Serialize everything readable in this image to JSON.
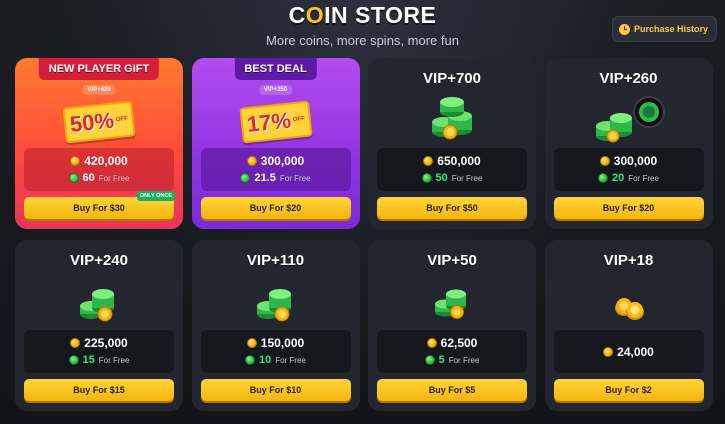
{
  "header": {
    "title_prefix": "C",
    "title_o": "O",
    "title_suffix": "IN STORE",
    "subtitle": "More coins, more spins, more fun",
    "history_label": "Purchase History"
  },
  "colors": {
    "accent": "#ffc21a",
    "gem_green": "#3ee07a",
    "buy_yellow": "#f6b50e",
    "orange_card": "#ff5a36",
    "purple_card": "#9a3ae6"
  },
  "cards": [
    {
      "ribbon": "NEW PLAYER GIFT",
      "vip_pill": "VIP+420",
      "discount_pct": "50%",
      "discount_off": "OFF",
      "coins": "420,000",
      "gems": "60",
      "for_free": "For Free",
      "buy": "Buy For $30",
      "badge": "ONLY ONCE"
    },
    {
      "ribbon": "BEST DEAL",
      "vip_pill": "VIP+250",
      "discount_pct": "17%",
      "discount_off": "OFF",
      "coins": "300,000",
      "gems": "21.5",
      "for_free": "For Free",
      "buy": "Buy For $20"
    },
    {
      "vip": "VIP+700",
      "coins": "650,000",
      "gems": "50",
      "for_free": "For Free",
      "buy": "Buy For $50",
      "icon": "coin-stack-large"
    },
    {
      "vip": "VIP+260",
      "coins": "300,000",
      "gems": "20",
      "for_free": "For Free",
      "buy": "Buy For $20",
      "icon": "coin-stack-with-chip"
    },
    {
      "vip": "VIP+240",
      "coins": "225,000",
      "gems": "15",
      "for_free": "For Free",
      "buy": "Buy For $15",
      "icon": "coin-stack-medium"
    },
    {
      "vip": "VIP+110",
      "coins": "150,000",
      "gems": "10",
      "for_free": "For Free",
      "buy": "Buy For $10",
      "icon": "coin-stack-medium"
    },
    {
      "vip": "VIP+50",
      "coins": "62,500",
      "gems": "5",
      "for_free": "For Free",
      "buy": "Buy For $5",
      "icon": "coin-stack-small"
    },
    {
      "vip": "VIP+18",
      "coins": "24,000",
      "buy": "Buy For $2",
      "icon": "gold-coins"
    }
  ]
}
